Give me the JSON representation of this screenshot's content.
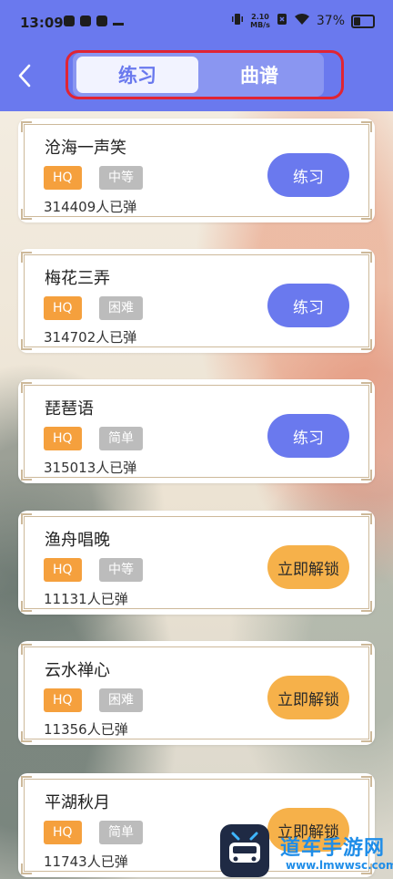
{
  "status_bar": {
    "time": "13:09",
    "net_speed_value": "2.10",
    "net_speed_unit": "MB/s",
    "battery_percent": "37%"
  },
  "header": {
    "tabs": [
      {
        "label": "练习",
        "active": true
      },
      {
        "label": "曲谱",
        "active": false
      }
    ]
  },
  "songs": [
    {
      "title": "沧海一声笑",
      "quality": "HQ",
      "difficulty": "中等",
      "plays": "314409人已弹",
      "action": "练习",
      "locked": false
    },
    {
      "title": "梅花三弄",
      "quality": "HQ",
      "difficulty": "困难",
      "plays": "314702人已弹",
      "action": "练习",
      "locked": false
    },
    {
      "title": "琵琶语",
      "quality": "HQ",
      "difficulty": "简单",
      "plays": "315013人已弹",
      "action": "练习",
      "locked": false
    },
    {
      "title": "渔舟唱晚",
      "quality": "HQ",
      "difficulty": "中等",
      "plays": "11131人已弹",
      "action": "立即解锁",
      "locked": true
    },
    {
      "title": "云水禅心",
      "quality": "HQ",
      "difficulty": "困难",
      "plays": "11356人已弹",
      "action": "立即解锁",
      "locked": true
    },
    {
      "title": "平湖秋月",
      "quality": "HQ",
      "difficulty": "简单",
      "plays": "11743人已弹",
      "action": "立即解锁",
      "locked": true
    }
  ],
  "watermark": {
    "text": "道车手游网",
    "url": "www.lmwwsc.com"
  },
  "colors": {
    "accent": "#6a79ee",
    "unlock": "#f6b14a",
    "hq_badge": "#f5a03d",
    "difficulty_badge": "#bcbcbc",
    "highlight_ring": "#e02433"
  }
}
